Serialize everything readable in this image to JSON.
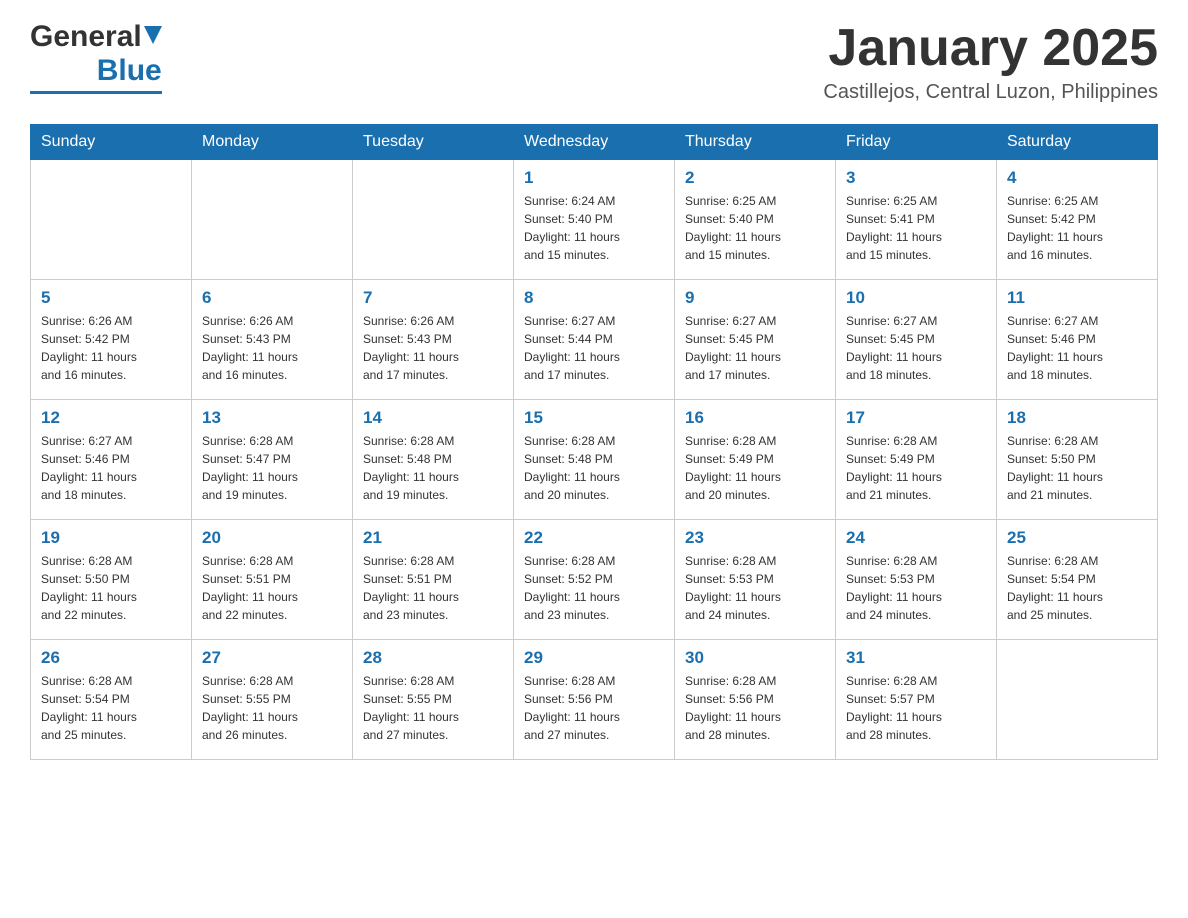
{
  "header": {
    "logo_general": "General",
    "logo_blue": "Blue",
    "month_title": "January 2025",
    "location": "Castillejos, Central Luzon, Philippines"
  },
  "days_of_week": [
    "Sunday",
    "Monday",
    "Tuesday",
    "Wednesday",
    "Thursday",
    "Friday",
    "Saturday"
  ],
  "weeks": [
    [
      {
        "day": "",
        "info": ""
      },
      {
        "day": "",
        "info": ""
      },
      {
        "day": "",
        "info": ""
      },
      {
        "day": "1",
        "info": "Sunrise: 6:24 AM\nSunset: 5:40 PM\nDaylight: 11 hours\nand 15 minutes."
      },
      {
        "day": "2",
        "info": "Sunrise: 6:25 AM\nSunset: 5:40 PM\nDaylight: 11 hours\nand 15 minutes."
      },
      {
        "day": "3",
        "info": "Sunrise: 6:25 AM\nSunset: 5:41 PM\nDaylight: 11 hours\nand 15 minutes."
      },
      {
        "day": "4",
        "info": "Sunrise: 6:25 AM\nSunset: 5:42 PM\nDaylight: 11 hours\nand 16 minutes."
      }
    ],
    [
      {
        "day": "5",
        "info": "Sunrise: 6:26 AM\nSunset: 5:42 PM\nDaylight: 11 hours\nand 16 minutes."
      },
      {
        "day": "6",
        "info": "Sunrise: 6:26 AM\nSunset: 5:43 PM\nDaylight: 11 hours\nand 16 minutes."
      },
      {
        "day": "7",
        "info": "Sunrise: 6:26 AM\nSunset: 5:43 PM\nDaylight: 11 hours\nand 17 minutes."
      },
      {
        "day": "8",
        "info": "Sunrise: 6:27 AM\nSunset: 5:44 PM\nDaylight: 11 hours\nand 17 minutes."
      },
      {
        "day": "9",
        "info": "Sunrise: 6:27 AM\nSunset: 5:45 PM\nDaylight: 11 hours\nand 17 minutes."
      },
      {
        "day": "10",
        "info": "Sunrise: 6:27 AM\nSunset: 5:45 PM\nDaylight: 11 hours\nand 18 minutes."
      },
      {
        "day": "11",
        "info": "Sunrise: 6:27 AM\nSunset: 5:46 PM\nDaylight: 11 hours\nand 18 minutes."
      }
    ],
    [
      {
        "day": "12",
        "info": "Sunrise: 6:27 AM\nSunset: 5:46 PM\nDaylight: 11 hours\nand 18 minutes."
      },
      {
        "day": "13",
        "info": "Sunrise: 6:28 AM\nSunset: 5:47 PM\nDaylight: 11 hours\nand 19 minutes."
      },
      {
        "day": "14",
        "info": "Sunrise: 6:28 AM\nSunset: 5:48 PM\nDaylight: 11 hours\nand 19 minutes."
      },
      {
        "day": "15",
        "info": "Sunrise: 6:28 AM\nSunset: 5:48 PM\nDaylight: 11 hours\nand 20 minutes."
      },
      {
        "day": "16",
        "info": "Sunrise: 6:28 AM\nSunset: 5:49 PM\nDaylight: 11 hours\nand 20 minutes."
      },
      {
        "day": "17",
        "info": "Sunrise: 6:28 AM\nSunset: 5:49 PM\nDaylight: 11 hours\nand 21 minutes."
      },
      {
        "day": "18",
        "info": "Sunrise: 6:28 AM\nSunset: 5:50 PM\nDaylight: 11 hours\nand 21 minutes."
      }
    ],
    [
      {
        "day": "19",
        "info": "Sunrise: 6:28 AM\nSunset: 5:50 PM\nDaylight: 11 hours\nand 22 minutes."
      },
      {
        "day": "20",
        "info": "Sunrise: 6:28 AM\nSunset: 5:51 PM\nDaylight: 11 hours\nand 22 minutes."
      },
      {
        "day": "21",
        "info": "Sunrise: 6:28 AM\nSunset: 5:51 PM\nDaylight: 11 hours\nand 23 minutes."
      },
      {
        "day": "22",
        "info": "Sunrise: 6:28 AM\nSunset: 5:52 PM\nDaylight: 11 hours\nand 23 minutes."
      },
      {
        "day": "23",
        "info": "Sunrise: 6:28 AM\nSunset: 5:53 PM\nDaylight: 11 hours\nand 24 minutes."
      },
      {
        "day": "24",
        "info": "Sunrise: 6:28 AM\nSunset: 5:53 PM\nDaylight: 11 hours\nand 24 minutes."
      },
      {
        "day": "25",
        "info": "Sunrise: 6:28 AM\nSunset: 5:54 PM\nDaylight: 11 hours\nand 25 minutes."
      }
    ],
    [
      {
        "day": "26",
        "info": "Sunrise: 6:28 AM\nSunset: 5:54 PM\nDaylight: 11 hours\nand 25 minutes."
      },
      {
        "day": "27",
        "info": "Sunrise: 6:28 AM\nSunset: 5:55 PM\nDaylight: 11 hours\nand 26 minutes."
      },
      {
        "day": "28",
        "info": "Sunrise: 6:28 AM\nSunset: 5:55 PM\nDaylight: 11 hours\nand 27 minutes."
      },
      {
        "day": "29",
        "info": "Sunrise: 6:28 AM\nSunset: 5:56 PM\nDaylight: 11 hours\nand 27 minutes."
      },
      {
        "day": "30",
        "info": "Sunrise: 6:28 AM\nSunset: 5:56 PM\nDaylight: 11 hours\nand 28 minutes."
      },
      {
        "day": "31",
        "info": "Sunrise: 6:28 AM\nSunset: 5:57 PM\nDaylight: 11 hours\nand 28 minutes."
      },
      {
        "day": "",
        "info": ""
      }
    ]
  ]
}
